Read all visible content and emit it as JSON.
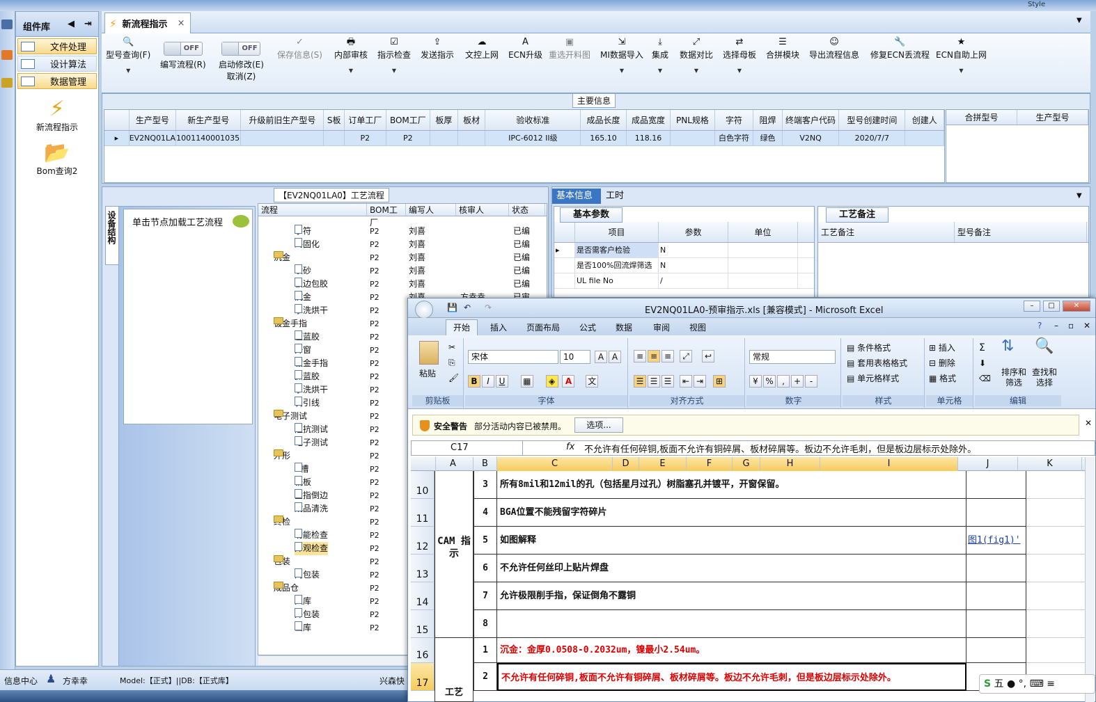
{
  "top": {
    "left_label": "组件库",
    "style_label": "Style"
  },
  "sidebar": {
    "groups": [
      {
        "label": "文件处理",
        "active": true
      },
      {
        "label": "设计算法",
        "active": false
      },
      {
        "label": "数据管理",
        "active": true
      }
    ],
    "items": [
      {
        "label": "新流程指示",
        "icon": "lightning-icon"
      },
      {
        "label": "Bom查询2",
        "icon": "folder-icon"
      }
    ]
  },
  "tab": {
    "label": "新流程指示"
  },
  "toolbar": {
    "items": [
      {
        "label": "型号查询(F)",
        "icon": "search-icon",
        "dropdown": true
      },
      {
        "label": "编写流程(R)",
        "toggle": "OFF"
      },
      {
        "label": "启动修改(E)",
        "label2": "取消(Z)",
        "toggle": "OFF"
      },
      {
        "label": "保存信息(S)",
        "icon": "check-icon",
        "disabled": true
      },
      {
        "label": "内部审核",
        "icon": "printer-icon",
        "dropdown": true
      },
      {
        "label": "指示检查",
        "icon": "checkbox-icon",
        "dropdown": true
      },
      {
        "label": "发送指示",
        "icon": "upload-icon"
      },
      {
        "label": "文控上网",
        "icon": "cloud-icon"
      },
      {
        "label": "ECN升级",
        "icon": "upgrade-icon"
      },
      {
        "label": "重选开料图",
        "icon": "image-icon",
        "disabled": true
      },
      {
        "label": "MI数据导入",
        "icon": "import-icon",
        "dropdown": true
      },
      {
        "label": "集成",
        "icon": "download-icon",
        "dropdown": true
      },
      {
        "label": "数据对比",
        "icon": "compare-icon",
        "dropdown": true
      },
      {
        "label": "选择母板",
        "icon": "shuffle-icon",
        "dropdown": true
      },
      {
        "label": "合拼模块",
        "icon": "list-icon"
      },
      {
        "label": "导出流程信息",
        "icon": "smile-icon"
      },
      {
        "label": "修复ECN丢流程",
        "icon": "wrench-icon"
      },
      {
        "label": "ECN自助上网",
        "icon": "star-icon",
        "dropdown": true
      }
    ]
  },
  "main_info": {
    "title": "主要信息",
    "columns": [
      "生产型号",
      "新生产型号",
      "升级前旧生产型号",
      "S板",
      "订单工厂",
      "BOM工厂",
      "板厚",
      "板材",
      "验收标准",
      "成品长度",
      "成品宽度",
      "PNL规格",
      "字符",
      "阻焊",
      "终端客户代码",
      "型号创建时间",
      "创建人"
    ],
    "row": [
      "EV2NQ01LA0",
      "10011400010358",
      "",
      "",
      "P2",
      "P2",
      "",
      "",
      "IPC-6012 II级",
      "165.10",
      "118.16",
      "",
      "白色字符",
      "绿色",
      "V2NQ",
      "2020/7/7",
      ""
    ],
    "side_columns": [
      "合拼型号",
      "生产型号"
    ]
  },
  "process": {
    "title": "【EV2NQ01LA0】工艺流程",
    "vertical_tab": "设备结构",
    "hint": "单击节点加载工艺流程",
    "columns": [
      "流程",
      "BOM工厂",
      "编写人",
      "核审人",
      "状态"
    ],
    "rows": [
      {
        "level": 2,
        "label": "字符",
        "bom": "P2",
        "writer": "刘喜",
        "reviewer": "",
        "status": "已编"
      },
      {
        "level": 2,
        "label": "终固化",
        "bom": "P2",
        "writer": "刘喜",
        "reviewer": "",
        "status": "已编"
      },
      {
        "level": 1,
        "label": "沉金",
        "bom": "P2",
        "writer": "刘喜",
        "reviewer": "",
        "status": "已编"
      },
      {
        "level": 2,
        "label": "喷砂",
        "bom": "P2",
        "writer": "刘喜",
        "reviewer": "",
        "status": "已编"
      },
      {
        "level": 2,
        "label": "板边包胶",
        "bom": "P2",
        "writer": "刘喜",
        "reviewer": "",
        "status": "已编"
      },
      {
        "level": 2,
        "label": "沉金",
        "bom": "P2",
        "writer": "刘喜",
        "reviewer": "方幸幸",
        "status": "已审"
      },
      {
        "level": 2,
        "label": "水洗烘干",
        "bom": "P2",
        "writer": "",
        "reviewer": "",
        "status": ""
      },
      {
        "level": 1,
        "label": "镀金手指",
        "bom": "P2",
        "writer": "",
        "reviewer": "",
        "status": ""
      },
      {
        "level": 2,
        "label": "压蓝胶",
        "bom": "P2",
        "writer": "",
        "reviewer": "",
        "status": ""
      },
      {
        "level": 2,
        "label": "开窗",
        "bom": "P2",
        "writer": "",
        "reviewer": "",
        "status": ""
      },
      {
        "level": 2,
        "label": "镀金手指",
        "bom": "P2",
        "writer": "",
        "reviewer": "",
        "status": ""
      },
      {
        "level": 2,
        "label": "撕蓝胶",
        "bom": "P2",
        "writer": "",
        "reviewer": "",
        "status": ""
      },
      {
        "level": 2,
        "label": "水洗烘干",
        "bom": "P2",
        "writer": "",
        "reviewer": "",
        "status": ""
      },
      {
        "level": 2,
        "label": "剥引线",
        "bom": "P2",
        "writer": "",
        "reviewer": "",
        "status": ""
      },
      {
        "level": 1,
        "label": "电子测试",
        "bom": "P2",
        "writer": "",
        "reviewer": "",
        "status": ""
      },
      {
        "level": 2,
        "label": "阻抗测试",
        "bom": "P2",
        "writer": "",
        "reviewer": "",
        "status": ""
      },
      {
        "level": 2,
        "label": "电子测试",
        "bom": "P2",
        "writer": "",
        "reviewer": "",
        "status": ""
      },
      {
        "level": 1,
        "label": "外形",
        "bom": "P2",
        "writer": "",
        "reviewer": "",
        "status": ""
      },
      {
        "level": 2,
        "label": "V槽",
        "bom": "P2",
        "writer": "",
        "reviewer": "",
        "status": ""
      },
      {
        "level": 2,
        "label": "铣板",
        "bom": "P2",
        "writer": "",
        "reviewer": "",
        "status": ""
      },
      {
        "level": 2,
        "label": "金指倒边",
        "bom": "P2",
        "writer": "",
        "reviewer": "",
        "status": ""
      },
      {
        "level": 2,
        "label": "成品清洗",
        "bom": "P2",
        "writer": "",
        "reviewer": "",
        "status": ""
      },
      {
        "level": 1,
        "label": "终检",
        "bom": "P2",
        "writer": "",
        "reviewer": "",
        "status": ""
      },
      {
        "level": 2,
        "label": "功能检查",
        "bom": "P2",
        "writer": "",
        "reviewer": "",
        "status": ""
      },
      {
        "level": 2,
        "label": "外观检查",
        "bom": "P2",
        "writer": "",
        "reviewer": "",
        "status": "",
        "selected": true
      },
      {
        "level": 1,
        "label": "包装",
        "bom": "P2",
        "writer": "",
        "reviewer": "",
        "status": ""
      },
      {
        "level": 2,
        "label": "内包装",
        "bom": "P2",
        "writer": "",
        "reviewer": "",
        "status": ""
      },
      {
        "level": 1,
        "label": "成品仓",
        "bom": "P2",
        "writer": "",
        "reviewer": "",
        "status": ""
      },
      {
        "level": 2,
        "label": "入库",
        "bom": "P2",
        "writer": "",
        "reviewer": "",
        "status": ""
      },
      {
        "level": 2,
        "label": "外包装",
        "bom": "P2",
        "writer": "",
        "reviewer": "",
        "status": ""
      },
      {
        "level": 2,
        "label": "出库",
        "bom": "P2",
        "writer": "",
        "reviewer": "",
        "status": ""
      }
    ]
  },
  "basic": {
    "tab_active": "基本信息",
    "tab_other": "工时",
    "params_tab": "基本参数",
    "params_cols": [
      "项目",
      "参数",
      "单位"
    ],
    "params_rows": [
      {
        "item": "是否需客户检验",
        "value": "N",
        "unit": ""
      },
      {
        "item": "是否100%回流焊筛选",
        "value": "N",
        "unit": ""
      },
      {
        "item": "UL file No",
        "value": "/",
        "unit": ""
      }
    ],
    "notes_tab": "工艺备注",
    "notes_cols": [
      "工艺备注",
      "型号备注"
    ]
  },
  "status": {
    "info": "信息中心",
    "user": "方幸幸",
    "model": "Model:【正式】||DB:【正式库】",
    "company": "兴森快"
  },
  "excel": {
    "title": "EV2NQ01LA0-预审指示.xls [兼容模式] - Microsoft Excel",
    "tabs": [
      "开始",
      "插入",
      "页面布局",
      "公式",
      "数据",
      "审阅",
      "视图"
    ],
    "groups": [
      "剪贴板",
      "字体",
      "对齐方式",
      "数字",
      "样式",
      "单元格",
      "编辑"
    ],
    "paste": "粘贴",
    "font": "宋体",
    "size": "10",
    "number_format": "常规",
    "style_items": [
      "条件格式",
      "套用表格格式",
      "单元格样式"
    ],
    "cell_items": [
      "插入",
      "删除",
      "格式"
    ],
    "edit_items": [
      "排序和筛选",
      "查找和选择"
    ],
    "security_title": "安全警告",
    "security_text": "部分活动内容已被禁用。",
    "security_button": "选项...",
    "name_box": "C17",
    "formula": "不允许有任何碎铜,板面不允许有铜碎屑、板材碎屑等。板边不允许毛刺，但是板边层标示处除外。",
    "cols": [
      "A",
      "B",
      "C",
      "D",
      "E",
      "F",
      "G",
      "H",
      "I",
      "J",
      "K"
    ],
    "cam_label": "CAM 指示",
    "rows": [
      {
        "row": "10",
        "num": "3",
        "text": "所有8mil和12mil的孔（包括星月过孔）树脂塞孔并镀平，开窗保留。",
        "red": false,
        "link": ""
      },
      {
        "row": "11",
        "num": "4",
        "text": "BGA位置不能残留字符碎片",
        "red": false,
        "link": ""
      },
      {
        "row": "12",
        "num": "5",
        "text": "如图解释",
        "red": false,
        "link": "图1(fig1)'"
      },
      {
        "row": "13",
        "num": "6",
        "text": "不允许任何丝印上贴片焊盘",
        "red": false,
        "link": ""
      },
      {
        "row": "14",
        "num": "7",
        "text": "允许极限削手指，保证倒角不露铜",
        "red": false,
        "link": ""
      },
      {
        "row": "15",
        "num": "8",
        "text": "",
        "red": false,
        "link": ""
      },
      {
        "row": "16",
        "num": "1",
        "text": "沉金：金厚0.0508-0.2032um，镍最小2.54um。",
        "red": true,
        "link": ""
      },
      {
        "row": "17",
        "num": "2",
        "text": "不允许有任何碎铜,板面不允许有铜碎屑、板材碎屑等。板边不允许毛刺，但是板边层标示处除外。",
        "red": true,
        "link": ""
      }
    ],
    "last_a": "工艺",
    "ime": "五"
  }
}
